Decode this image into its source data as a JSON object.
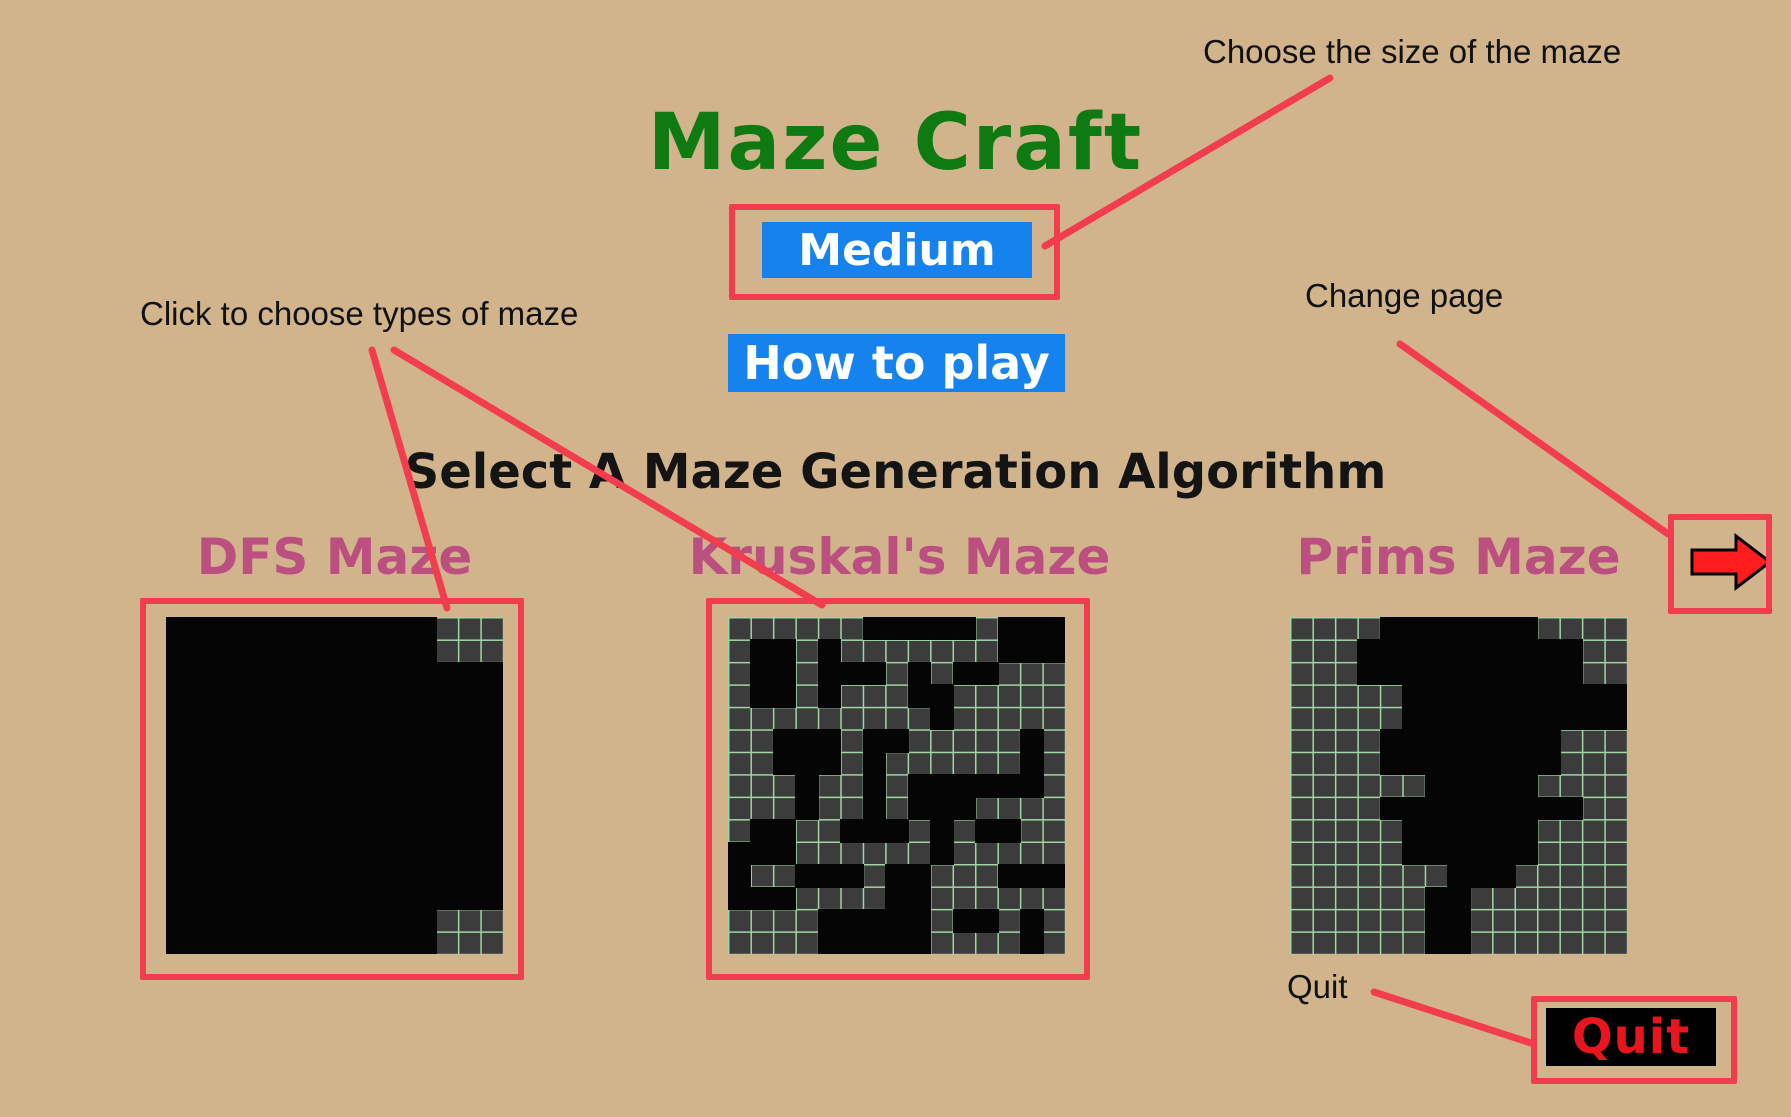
{
  "app": {
    "title": "Maze Craft",
    "size_button": "Medium",
    "how_to_play_button": "How to play",
    "subtitle": "Select A Maze Generation Algorithm",
    "quit_button": "Quit"
  },
  "mazes": [
    {
      "label": "DFS Maze"
    },
    {
      "label": "Kruskal's Maze"
    },
    {
      "label": "Prims Maze"
    }
  ],
  "annotations": {
    "size": "Choose the size of the maze",
    "types": "Click to choose types of maze",
    "change_page": "Change page",
    "quit": "Quit"
  },
  "colors": {
    "background": "#d2b48c",
    "title": "#0f7a12",
    "button_blue": "#1582ee",
    "maze_label": "#bb4f80",
    "annotation_red": "#f23d4e",
    "quit_text": "#e8141e"
  },
  "icons": {
    "next_page": "right-arrow-icon"
  }
}
